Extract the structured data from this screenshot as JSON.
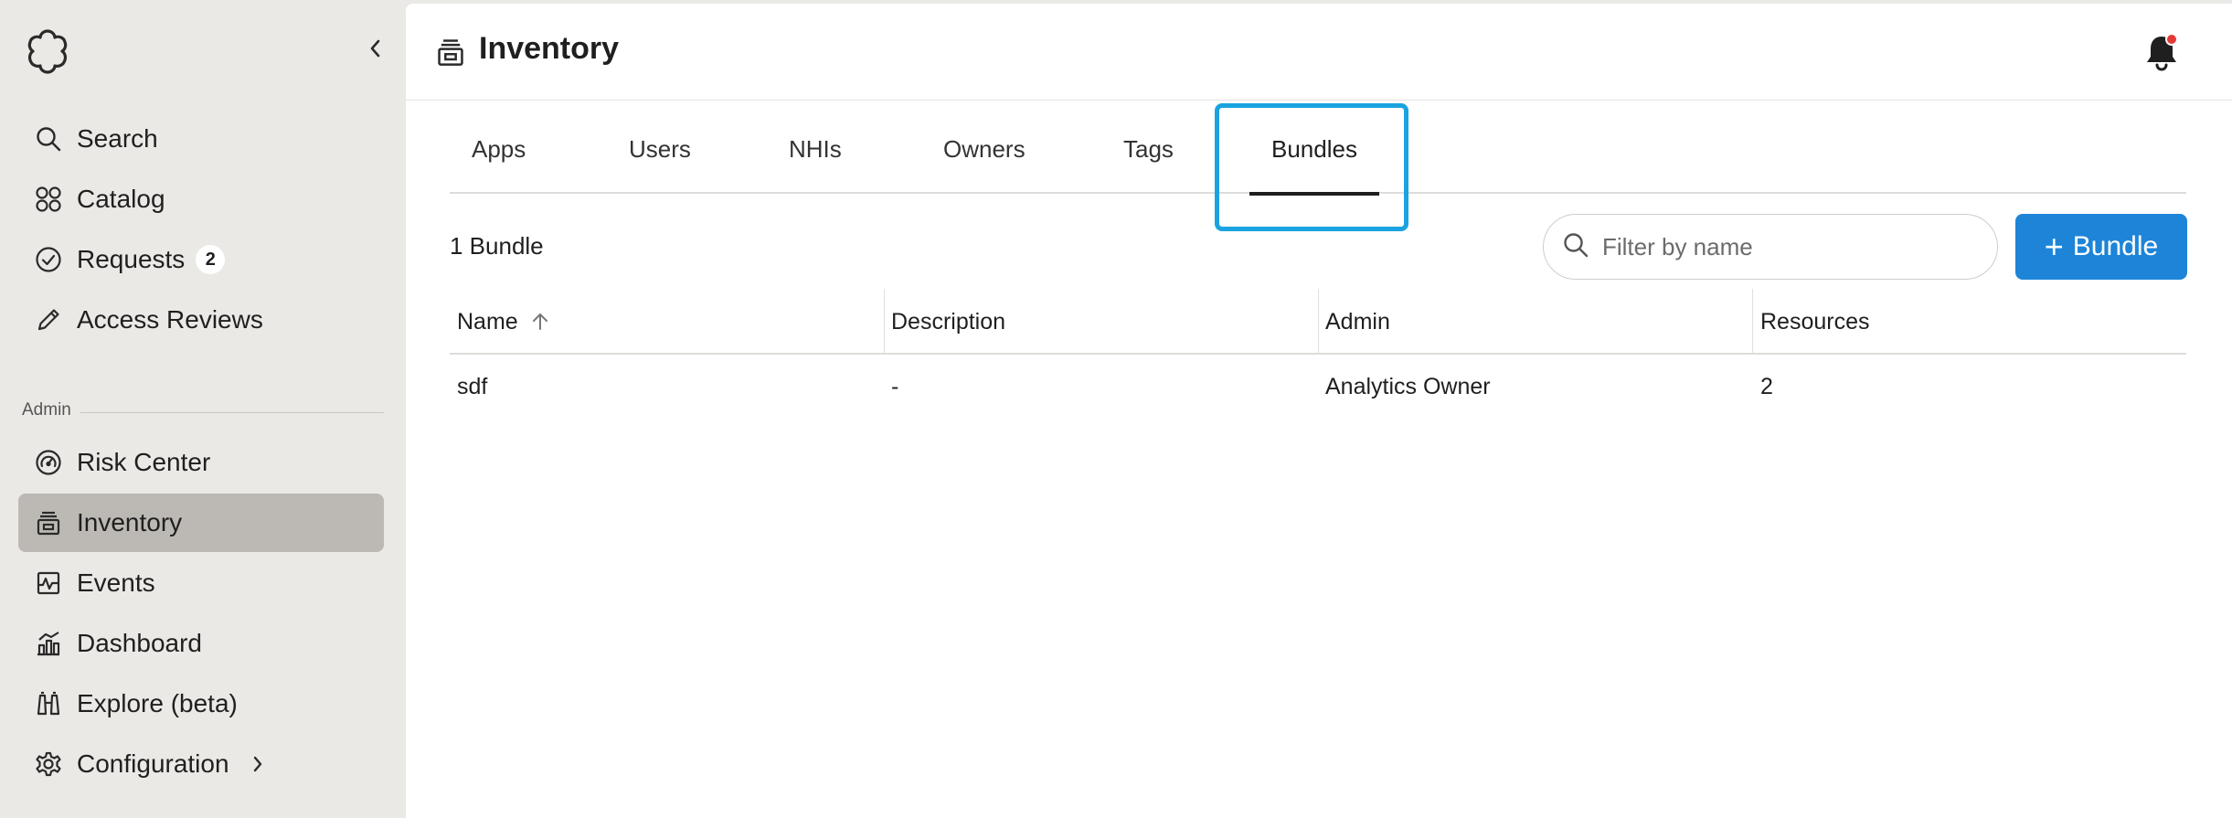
{
  "sidebar": {
    "nav": [
      {
        "label": "Search",
        "icon": "search-icon"
      },
      {
        "label": "Catalog",
        "icon": "catalog-icon"
      },
      {
        "label": "Requests",
        "icon": "requests-icon",
        "badge": "2"
      },
      {
        "label": "Access Reviews",
        "icon": "pencil-icon"
      }
    ],
    "admin_label": "Admin",
    "admin_nav": [
      {
        "label": "Risk Center",
        "icon": "risk-gauge-icon"
      },
      {
        "label": "Inventory",
        "icon": "inventory-icon",
        "active": true
      },
      {
        "label": "Events",
        "icon": "events-icon"
      },
      {
        "label": "Dashboard",
        "icon": "dashboard-icon"
      },
      {
        "label": "Explore (beta)",
        "icon": "binoculars-icon"
      },
      {
        "label": "Configuration",
        "icon": "gear-icon",
        "has_submenu": true
      }
    ]
  },
  "header": {
    "title": "Inventory",
    "notification_dot_color": "#e53935"
  },
  "tabs": [
    {
      "label": "Apps"
    },
    {
      "label": "Users"
    },
    {
      "label": "NHIs"
    },
    {
      "label": "Owners"
    },
    {
      "label": "Tags"
    },
    {
      "label": "Bundles",
      "active": true
    }
  ],
  "toolbar": {
    "count_label": "1 Bundle",
    "filter_placeholder": "Filter by name",
    "add_button_label": "Bundle"
  },
  "table": {
    "columns": [
      "Name",
      "Description",
      "Admin",
      "Resources"
    ],
    "sort_column": "Name",
    "sort_direction": "ascending",
    "rows": [
      [
        "sdf",
        "-",
        "Analytics Owner",
        "2"
      ]
    ]
  },
  "colors": {
    "accent": "#1d84d8",
    "focus_ring": "#1aa3e0",
    "sidebar_bg": "#ebe9e6",
    "active_nav_bg": "#bcb9b4"
  }
}
